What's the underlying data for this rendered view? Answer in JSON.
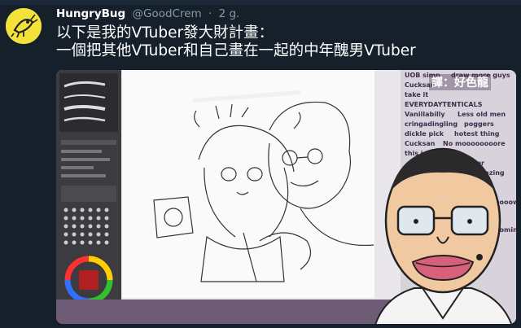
{
  "tweet": {
    "display_name": "HungryBug",
    "handle": "@GoodCrem",
    "separator": "·",
    "time": "2 g.",
    "text_line1": "以下是我的VTuber發大財計畫：",
    "text_line2": "一個把其他VTuber和自己畫在一起的中年醜男VTuber"
  },
  "media": {
    "translator_credit": "譯：好色龍",
    "chat_lines": [
      "UOB simp",
      "draw more guys",
      "Cucksan",
      "take it",
      "EVERYDAYTENTICALS",
      "Vanillabilly",
      "Less old men",
      "cringadingling",
      "poggers",
      "dickle pick",
      "hotest thing",
      "Cucksan",
      "No moooooooore",
      "this is so much",
      "inside her",
      "manazing",
      "oooow",
      "ooming"
    ]
  },
  "colors": {
    "background": "#15202b",
    "handle": "#8899a6",
    "avatar_bg": "#f3e23a",
    "tool_panel": "#3b3b40",
    "chat_bg": "#d8d2dc",
    "stream_strip": "#6e5c76"
  },
  "icons": [
    "hungrybug-avatar-icon",
    "color-wheel-icon",
    "brush-preview-icon"
  ]
}
